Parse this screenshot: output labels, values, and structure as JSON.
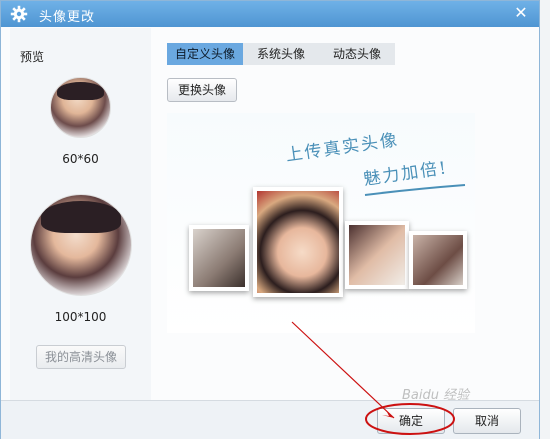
{
  "window": {
    "title": "头像更改",
    "close_symbol": "✕"
  },
  "left_panel": {
    "preview_label": "预览",
    "small_size_label": "60*60",
    "large_size_label": "100*100",
    "hd_avatar_button": "我的高清头像"
  },
  "tabs": [
    {
      "label": "自定义头像",
      "active": true
    },
    {
      "label": "系统头像",
      "active": false
    },
    {
      "label": "动态头像",
      "active": false
    }
  ],
  "change_avatar_button": "更换头像",
  "promo": {
    "line1": "上传真实头像",
    "line2": "魅力加倍!"
  },
  "footer": {
    "ok_label": "确定",
    "cancel_label": "取消"
  },
  "watermark": "Baidu 经验",
  "colors": {
    "titlebar": "#5a9fdc",
    "active_tab": "#6aa8e0",
    "annotation": "#cc1111"
  },
  "icons": [
    "gear-icon",
    "close-icon"
  ]
}
